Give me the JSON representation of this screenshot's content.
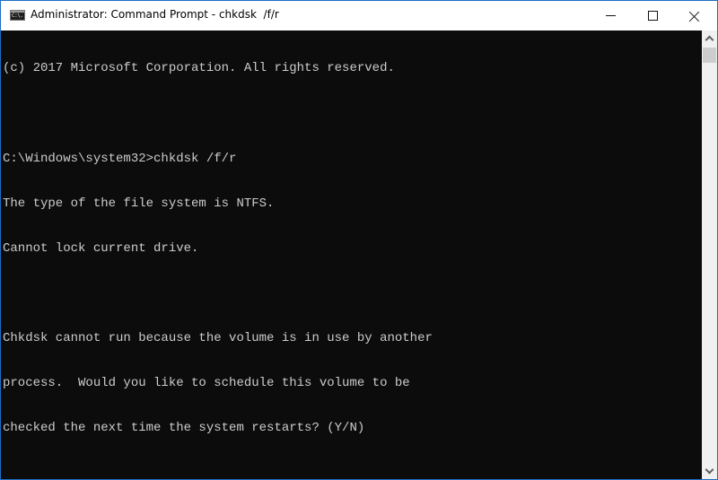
{
  "window": {
    "title": "Administrator: Command Prompt - chkdsk  /f/r",
    "app_icon": "command-prompt-icon",
    "app_icon_glyph": "C:\\.",
    "controls": {
      "minimize": "minimize-icon",
      "maximize": "maximize-icon",
      "close": "close-icon"
    },
    "accent_color": "#1a6fc4"
  },
  "console": {
    "background_color": "#0c0c0c",
    "text_color": "#cccccc",
    "lines": [
      "(c) 2017 Microsoft Corporation. All rights reserved.",
      "",
      "C:\\Windows\\system32>chkdsk /f/r",
      "The type of the file system is NTFS.",
      "Cannot lock current drive.",
      "",
      "Chkdsk cannot run because the volume is in use by another",
      "process.  Would you like to schedule this volume to be",
      "checked the next time the system restarts? (Y/N)"
    ]
  },
  "scrollbar": {
    "up_icon": "chevron-up-icon",
    "down_icon": "chevron-down-icon"
  }
}
